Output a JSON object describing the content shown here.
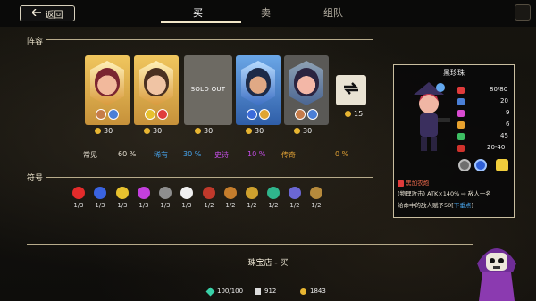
{
  "topbar": {
    "back_label": "返回",
    "tabs": [
      {
        "label": "买",
        "active": true
      },
      {
        "label": "卖",
        "active": false
      },
      {
        "label": "组队",
        "active": false
      }
    ]
  },
  "lineup": {
    "title": "阵容",
    "cards": [
      {
        "frame": "gold",
        "price": "30",
        "sold_out": false,
        "icons": [
          "#c67c4a",
          "#4a7fd6"
        ]
      },
      {
        "frame": "gold",
        "price": "30",
        "sold_out": false,
        "icons": [
          "#e7c12e",
          "#e03b3b"
        ]
      },
      {
        "frame": "grey",
        "price": "30",
        "sold_out": true,
        "sold_label": "SOLD OUT",
        "icons": []
      },
      {
        "frame": "blue",
        "price": "30",
        "sold_out": false,
        "icons": [
          "#3b6bdb",
          "#e0a531"
        ]
      },
      {
        "frame": "grey",
        "price": "30",
        "sold_out": false,
        "icons": [
          "#c67c4a",
          "#4a7fd6"
        ]
      }
    ],
    "refresh_price": "15",
    "rarity": [
      {
        "label": "常见",
        "value": "60 %",
        "color": "#e8e2d4"
      },
      {
        "label": "稀有",
        "value": "30 %",
        "color": "#47a6f0"
      },
      {
        "label": "史诗",
        "value": "10 %",
        "color": "#c64ee9"
      },
      {
        "label": "传奇",
        "value": "0 %",
        "color": "#e0a135"
      }
    ]
  },
  "symbols": {
    "title": "符号",
    "items": [
      {
        "color": "#e32b2b",
        "count": "1/3"
      },
      {
        "color": "#3a63e0",
        "count": "1/3"
      },
      {
        "color": "#e7c12e",
        "count": "1/3"
      },
      {
        "color": "#c33fdd",
        "count": "1/3"
      },
      {
        "color": "#8e8e8e",
        "count": "1/3"
      },
      {
        "color": "#f0f0f0",
        "count": "1/3"
      },
      {
        "color": "#c0392b",
        "count": "1/2"
      },
      {
        "color": "#c57d2c",
        "count": "1/2"
      },
      {
        "color": "#cfa12e",
        "count": "1/2"
      },
      {
        "color": "#2fb58c",
        "count": "1/2"
      },
      {
        "color": "#6b67d4",
        "count": "1/2"
      },
      {
        "color": "#b68a3c",
        "count": "1/2"
      }
    ]
  },
  "hero_panel": {
    "name": "黑珍珠",
    "stats": [
      {
        "icon_color": "#e03b3b",
        "value": "80/80"
      },
      {
        "icon_color": "#4a7fd6",
        "value": "20"
      },
      {
        "icon_color": "#d94bd1",
        "value": "9"
      },
      {
        "icon_color": "#e7a12e",
        "value": "6"
      },
      {
        "icon_color": "#3dbf63",
        "value": "45"
      },
      {
        "icon_color": "#d0322c",
        "value": "20-40"
      }
    ],
    "skill_name": "黑加农炮",
    "skill_desc_1": "(物理攻击) ATK×140% ⇨ 敌人一名",
    "skill_desc_2": "给命中的敌人赋予50[",
    "skill_link": "下垂点",
    "skill_desc_3": "]"
  },
  "shop": {
    "title": "珠宝店 - 买"
  },
  "resources": {
    "gems": "100/100",
    "icon2_value": "912",
    "gold": "1843"
  }
}
